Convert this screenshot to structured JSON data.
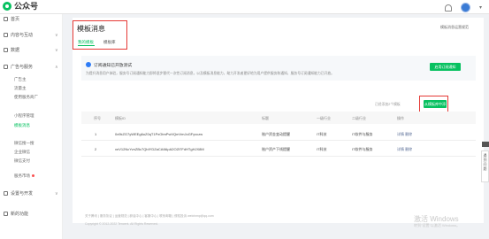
{
  "app": {
    "name": "公众号"
  },
  "sidebar": {
    "items": [
      {
        "label": "首页"
      },
      {
        "label": "内容与互动"
      },
      {
        "label": "数据"
      },
      {
        "label": "广告与服务"
      },
      {
        "label": "设置与开发"
      },
      {
        "label": "新的功能"
      }
    ],
    "subitems": [
      {
        "label": "广告主"
      },
      {
        "label": "流量主"
      },
      {
        "label": "使用服务商广"
      },
      {
        "label": "小程序管理"
      },
      {
        "label": "模板消息"
      },
      {
        "label": "微信搜一搜"
      },
      {
        "label": "企业微信"
      },
      {
        "label": "微信支付"
      },
      {
        "label": "服务市场"
      }
    ]
  },
  "page": {
    "title": "模板消息",
    "tabs": [
      {
        "label": "我的模板"
      },
      {
        "label": "模板库"
      }
    ],
    "top_link": "模板消息运营规范"
  },
  "notice": {
    "title": "订阅通知已开放测试",
    "desc": "为提升消息用户体验，服务号订阅通知能力即将逐步替代一次性订阅消息，以及模板消息能力，助力开发者更好地为用户提供服务和通知，服务号订阅通知能力已开放。",
    "button": "启用订阅通知"
  },
  "quota_text": "已经添加2个模板",
  "add_button": "从模板库中添加",
  "table": {
    "headers": [
      "序号",
      "模板ID",
      "标题",
      "一级行业",
      "二级行业",
      "操作"
    ],
    "rows": [
      {
        "index": "1",
        "id": "0x9kZG7yWEEg6uZ0qT1PxGtmPwVQmVmJoGFyvczw",
        "title": "账户资金变动提醒",
        "industry1": "IT科技",
        "industry2": "IT软件与服务",
        "actions": "详情 删除"
      },
      {
        "index": "2",
        "id": "xnV12NcYvnZBc7QbIYDZaCAfAIpA2OZt7FdHTgHJX8M",
        "title": "账户资产下线提醒",
        "industry1": "IT科技",
        "industry2": "IT软件与服务",
        "actions": "详情 删除"
      }
    ]
  },
  "footer": {
    "links": "关于腾讯 | 服务协议 | 运营规范 | 辟谣中心 | 客服中心 | 联系邮箱 | 侵权投诉 weixinmp@qq.com",
    "copyright": "Copyright © 2012-2022 Tencent. All Rights Reserved."
  },
  "watermark": {
    "title": "激活 Windows",
    "sub": "转到\"设置\"以激活 Windows。"
  },
  "float_help": "遇到问题"
}
